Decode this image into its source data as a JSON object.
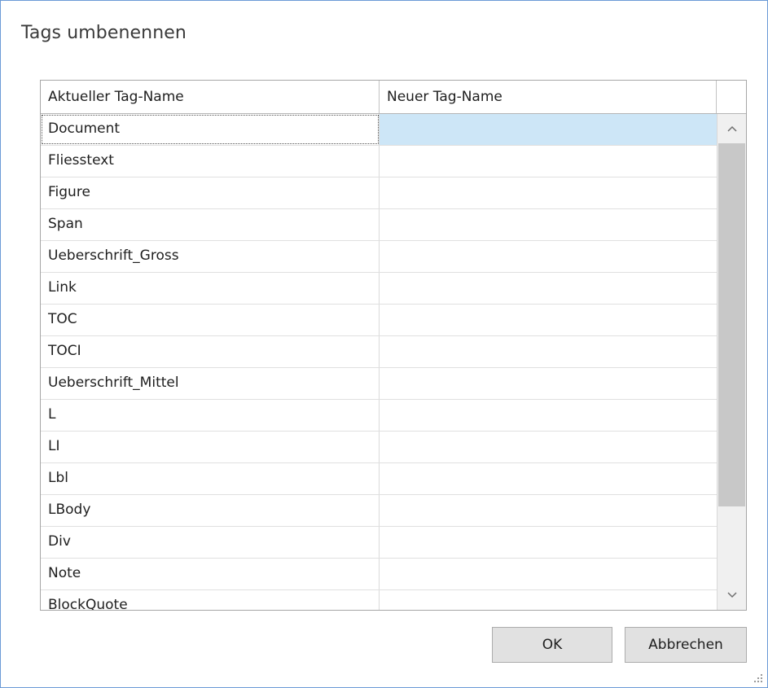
{
  "dialog": {
    "title": "Tags umbenennen"
  },
  "grid": {
    "columns": [
      "Aktueller Tag-Name",
      "Neuer Tag-Name"
    ],
    "rows": [
      {
        "current": "Document",
        "new": ""
      },
      {
        "current": "Fliesstext",
        "new": ""
      },
      {
        "current": "Figure",
        "new": ""
      },
      {
        "current": "Span",
        "new": ""
      },
      {
        "current": "Ueberschrift_Gross",
        "new": ""
      },
      {
        "current": "Link",
        "new": ""
      },
      {
        "current": "TOC",
        "new": ""
      },
      {
        "current": "TOCI",
        "new": ""
      },
      {
        "current": "Ueberschrift_Mittel",
        "new": ""
      },
      {
        "current": "L",
        "new": ""
      },
      {
        "current": "LI",
        "new": ""
      },
      {
        "current": "Lbl",
        "new": ""
      },
      {
        "current": "LBody",
        "new": ""
      },
      {
        "current": "Div",
        "new": ""
      },
      {
        "current": "Note",
        "new": ""
      },
      {
        "current": "BlockQuote",
        "new": ""
      }
    ],
    "selected_row": 0,
    "scroll_up_icon": "chevron-up-icon",
    "scroll_down_icon": "chevron-down-icon"
  },
  "buttons": {
    "ok_label": "OK",
    "cancel_label": "Abbrechen"
  },
  "colors": {
    "window_border": "#6b9ad6",
    "selection": "#cde6f7",
    "button_face": "#e1e1e1"
  }
}
